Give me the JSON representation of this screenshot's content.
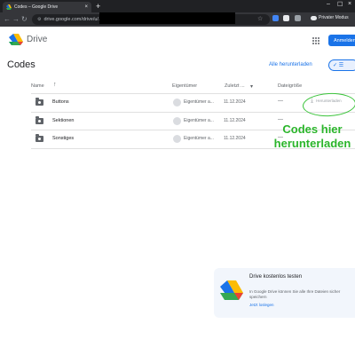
{
  "browser": {
    "tab_title": "Codes – Google Drive",
    "new_tab": "+",
    "address": "drive.google.com/drive/u/...",
    "private_label": "Privater Modus"
  },
  "drive": {
    "app_name": "Drive",
    "signin_label": "Anmelden"
  },
  "page": {
    "title": "Codes",
    "download_all": "Alle herunterladen",
    "view_toggle_label": "✓ ☰"
  },
  "table": {
    "headers": {
      "name": "Name",
      "owner": "Eigentümer",
      "modified": "Zuletzt ...",
      "size": "Dateigröße"
    },
    "rows": [
      {
        "name": "Buttons",
        "owner": "Eigentümer a...",
        "date": "11.12.2024",
        "size": "—",
        "download": "Herunterladen"
      },
      {
        "name": "Sektionen",
        "owner": "Eigentümer a...",
        "date": "11.12.2024",
        "size": "—"
      },
      {
        "name": "Sonstiges",
        "owner": "Eigentümer a...",
        "date": "11.12.2024",
        "size": "—"
      }
    ]
  },
  "annotation": {
    "line1": "Codes hier",
    "line2": "herunterladen",
    "color": "#2bb52b"
  },
  "promo": {
    "title": "Drive kostenlos testen",
    "text": "In Google Drive können Sie alle Ihre Dateien sicher speichern",
    "link": "Jetzt loslegen"
  },
  "colors": {
    "accent": "#1a73e8",
    "chrome_dark": "#202124",
    "chrome_toolbar": "#35363a"
  }
}
